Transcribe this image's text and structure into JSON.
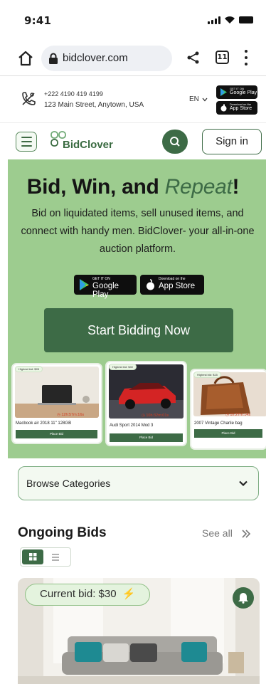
{
  "status_bar": {
    "time": "9:41"
  },
  "browser": {
    "url": "bidclover.com",
    "tab_count": "11"
  },
  "contact": {
    "phone": "+222 4190 419 4199",
    "address": "123 Main Street, Anytown, USA",
    "language": "EN",
    "google_play_small": "GET IT ON",
    "google_play_large": "Google Play",
    "app_store_small": "Download on the",
    "app_store_large": "App Store"
  },
  "nav": {
    "logo_text": "BidClover",
    "signin_label": "Sign in"
  },
  "hero": {
    "title_main": "Bid, Win, and ",
    "title_accent": "Repeat",
    "title_end": "!",
    "description": "Bid on liquidated items, sell unused items, and connect with handy men. BidClover- your all-in-one auction platform.",
    "google_play_small": "GET IT ON",
    "google_play_large": "Google Play",
    "app_store_small": "Download on the",
    "app_store_large": "App Store",
    "cta_label": "Start Bidding Now"
  },
  "cards": [
    {
      "bid": "Highest bid: $28",
      "timer": "12h:57m:16s",
      "title": "Macbook air 2018 11\" 128GB",
      "button": "Place Bid"
    },
    {
      "bid": "Highest bid: $40",
      "timer": "10h:32m:01s",
      "title": "Audi Sport 2014 Mod 3",
      "button": "Place Bid"
    },
    {
      "bid": "Highest bid: $15",
      "timer": "1h:27m:14s",
      "title": "2007 Vintage Charlie bag",
      "button": "Place Bid"
    }
  ],
  "browse": {
    "label": "Browse Categories"
  },
  "ongoing": {
    "title": "Ongoing Bids",
    "see_all": "See all",
    "current_bid": "Current bid: $30"
  },
  "colors": {
    "brand_green": "#3d6b46",
    "hero_bg": "#9dcc8f",
    "timer_red": "#d23b1f"
  },
  "icons": [
    "home-icon",
    "lock-icon",
    "share-icon",
    "tabs-icon",
    "more-icon",
    "phone-icon",
    "chevron-down-icon",
    "menu-icon",
    "search-icon",
    "clock-icon",
    "grid-view-icon",
    "list-view-icon",
    "double-chevron-right-icon",
    "bell-icon",
    "lightning-icon"
  ]
}
